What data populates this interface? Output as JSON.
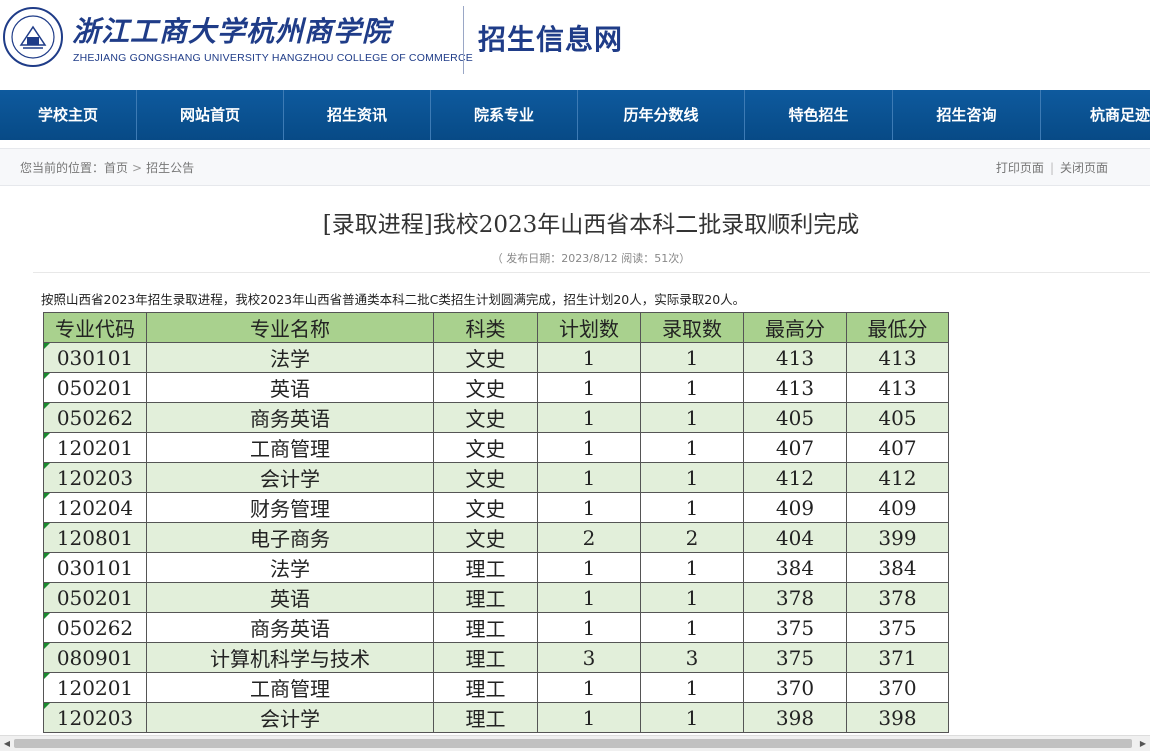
{
  "header": {
    "logo_cn": "浙江工商大学杭州商学院",
    "logo_en": "ZHEJIANG GONGSHANG UNIVERSITY HANGZHOU COLLEGE OF COMMERCE",
    "site_name": "招生信息网"
  },
  "nav": {
    "items": [
      {
        "label": "学校主页"
      },
      {
        "label": "网站首页"
      },
      {
        "label": "招生资讯"
      },
      {
        "label": "院系专业"
      },
      {
        "label": "历年分数线"
      },
      {
        "label": "特色招生"
      },
      {
        "label": "招生咨询"
      },
      {
        "label": "杭商足迹"
      }
    ]
  },
  "breadcrumb": {
    "prefix": "您当前的位置：",
    "home": "首页",
    "separator": ">",
    "current": "招生公告"
  },
  "tools": {
    "print": "打印页面",
    "divider": "|",
    "close": "关闭页面"
  },
  "article": {
    "title": "[录取进程]我校2023年山西省本科二批录取顺利完成",
    "meta": "（ 发布日期：2023/8/12  阅读：51次）",
    "intro": "按照山西省2023年招生录取进程，我校2023年山西省普通类本科二批C类招生计划圆满完成，招生计划20人，实际录取20人。"
  },
  "table": {
    "headers": [
      "专业代码",
      "专业名称",
      "科类",
      "计划数",
      "录取数",
      "最高分",
      "最低分"
    ],
    "rows": [
      [
        "030101",
        "法学",
        "文史",
        "1",
        "1",
        "413",
        "413"
      ],
      [
        "050201",
        "英语",
        "文史",
        "1",
        "1",
        "413",
        "413"
      ],
      [
        "050262",
        "商务英语",
        "文史",
        "1",
        "1",
        "405",
        "405"
      ],
      [
        "120201",
        "工商管理",
        "文史",
        "1",
        "1",
        "407",
        "407"
      ],
      [
        "120203",
        "会计学",
        "文史",
        "1",
        "1",
        "412",
        "412"
      ],
      [
        "120204",
        "财务管理",
        "文史",
        "1",
        "1",
        "409",
        "409"
      ],
      [
        "120801",
        "电子商务",
        "文史",
        "2",
        "2",
        "404",
        "399"
      ],
      [
        "030101",
        "法学",
        "理工",
        "1",
        "1",
        "384",
        "384"
      ],
      [
        "050201",
        "英语",
        "理工",
        "1",
        "1",
        "378",
        "378"
      ],
      [
        "050262",
        "商务英语",
        "理工",
        "1",
        "1",
        "375",
        "375"
      ],
      [
        "080901",
        "计算机科学与技术",
        "理工",
        "3",
        "3",
        "375",
        "371"
      ],
      [
        "120201",
        "工商管理",
        "理工",
        "1",
        "1",
        "370",
        "370"
      ],
      [
        "120203",
        "会计学",
        "理工",
        "1",
        "1",
        "398",
        "398"
      ]
    ]
  },
  "colors": {
    "brand_blue": "#1f3c88",
    "nav_blue": "#0b5393",
    "table_header_green": "#a9d18e",
    "table_alt_green": "#e2efda"
  },
  "icons": {
    "logo": "university-seal-icon",
    "scroll_left": "scroll-left-arrow-icon",
    "scroll_right": "scroll-right-arrow-icon"
  }
}
